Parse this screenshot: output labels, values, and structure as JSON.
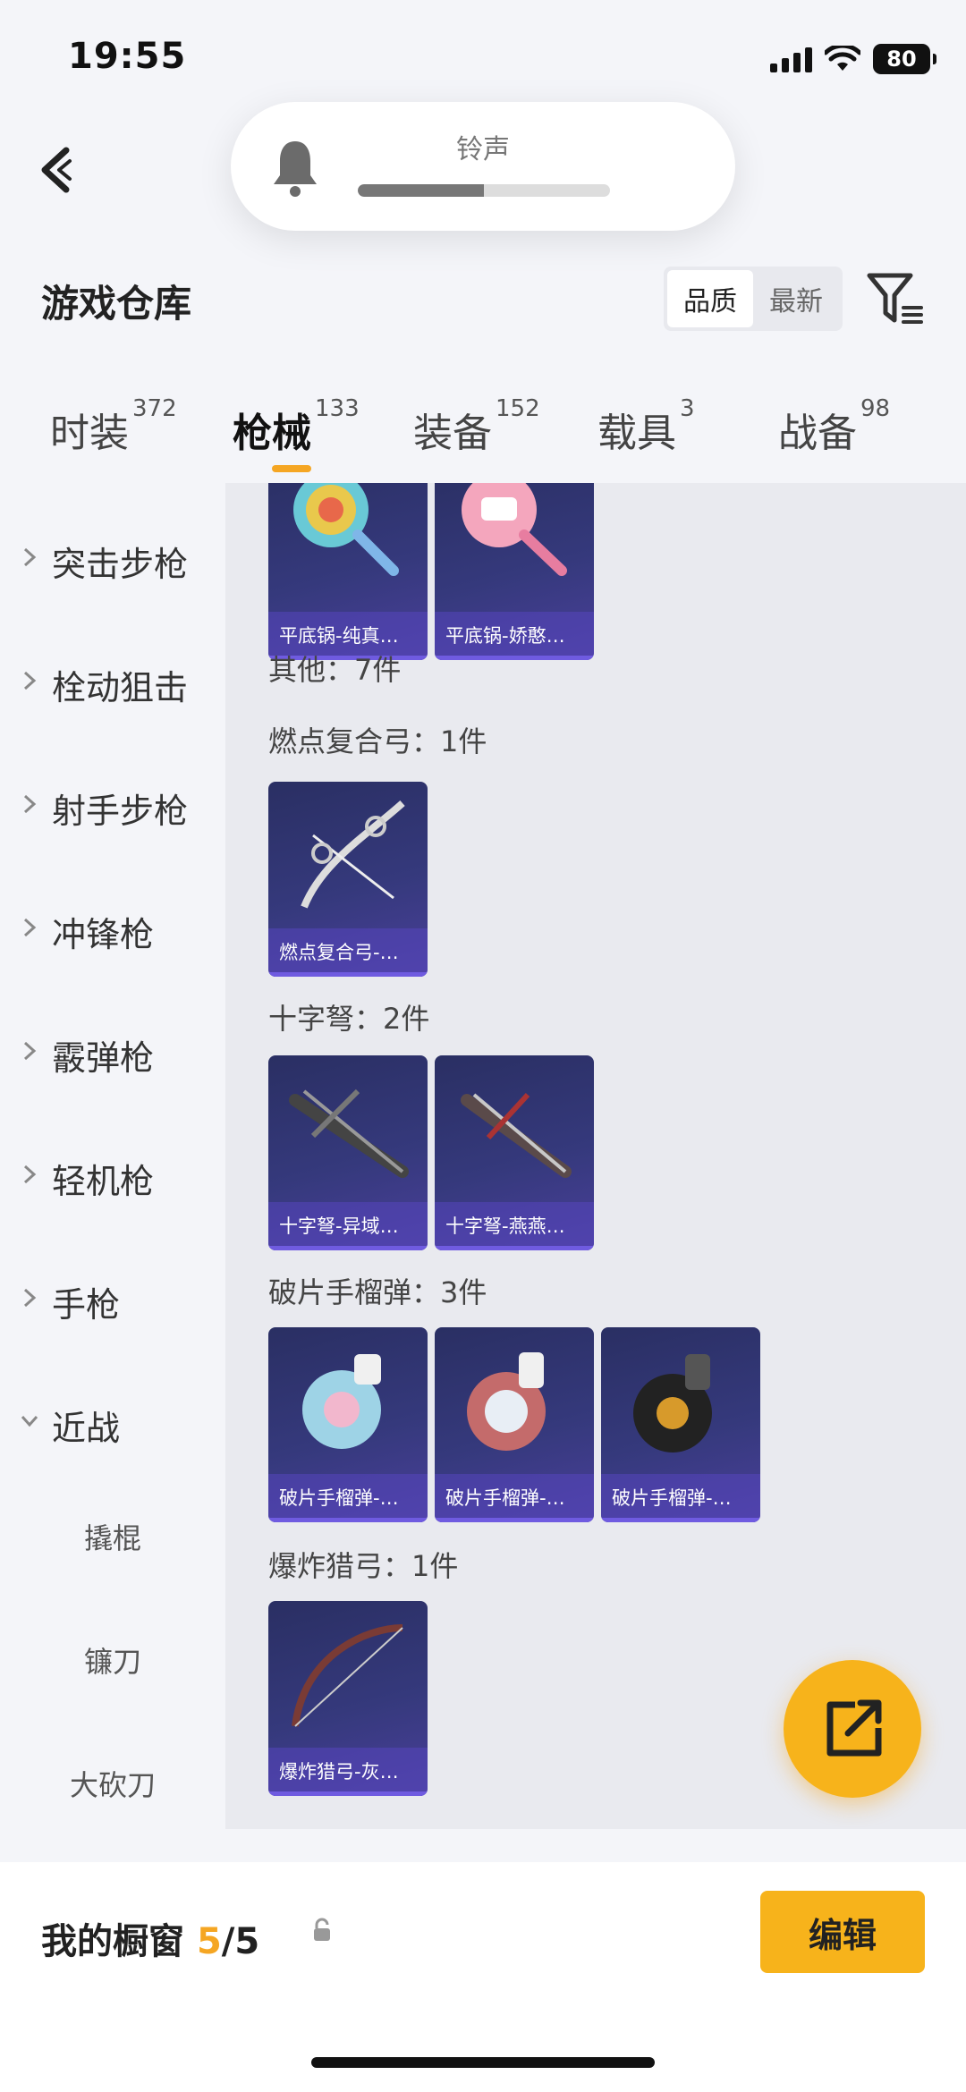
{
  "status": {
    "time": "19:55",
    "battery": "80"
  },
  "volume": {
    "label": "铃声",
    "level": 0.5
  },
  "header": {
    "title": "游戏仓库",
    "sort_options": [
      "品质",
      "最新"
    ],
    "sort_active": "品质"
  },
  "tabs": [
    {
      "label": "时装",
      "count": "372"
    },
    {
      "label": "枪械",
      "count": "133",
      "active": true
    },
    {
      "label": "装备",
      "count": "152"
    },
    {
      "label": "载具",
      "count": "3"
    },
    {
      "label": "战备",
      "count": "98"
    }
  ],
  "sidebar": {
    "items": [
      "突击步枪",
      "栓动狙击",
      "射手步枪",
      "冲锋枪",
      "霰弹枪",
      "轻机枪",
      "手枪",
      "近战"
    ],
    "sub_items": [
      "撬棍",
      "镰刀",
      "大砍刀"
    ]
  },
  "content": {
    "top_cards": [
      "平底锅-纯真…",
      "平底锅-娇憨…"
    ],
    "other_heading": "其他：7件",
    "groups": [
      {
        "heading": "燃点复合弓：1件",
        "cards": [
          "燃点复合弓-…"
        ]
      },
      {
        "heading": "十字弩：2件",
        "cards": [
          "十字弩-异域…",
          "十字弩-燕燕…"
        ]
      },
      {
        "heading": "破片手榴弹：3件",
        "cards": [
          "破片手榴弹-…",
          "破片手榴弹-…",
          "破片手榴弹-…"
        ]
      },
      {
        "heading": "爆炸猎弓：1件",
        "cards": [
          "爆炸猎弓-灰…"
        ]
      }
    ]
  },
  "bottom": {
    "title": "我的橱窗",
    "count_current": "5",
    "count_total": "/5",
    "edit_label": "编辑"
  },
  "colors": {
    "accent": "#f7b31b",
    "card_bg": "#2f3470",
    "page_bg": "#f4f5f9"
  },
  "icons": [
    "back-arrow-icon",
    "bell-icon",
    "filter-icon",
    "chevron-right-icon",
    "chevron-down-icon",
    "lock-icon",
    "share-icon"
  ]
}
